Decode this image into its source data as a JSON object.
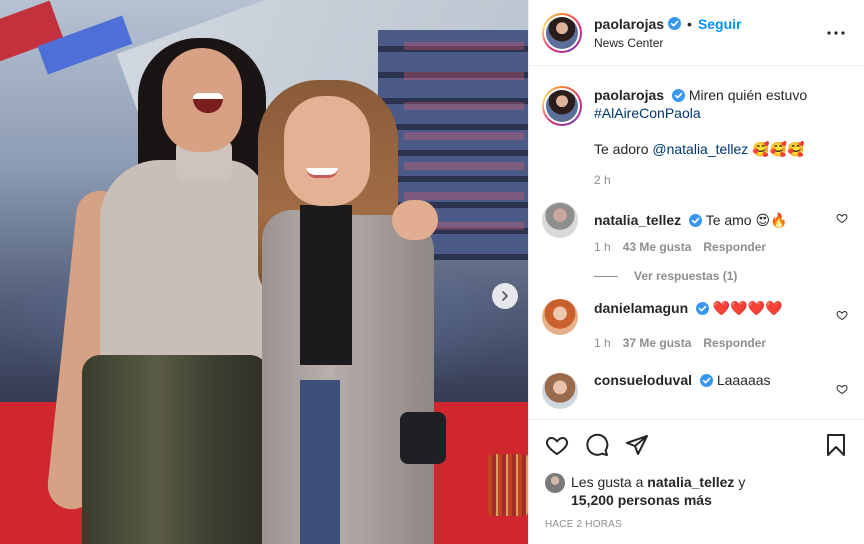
{
  "header": {
    "username": "paolarojas",
    "separator": "•",
    "follow_label": "Seguir",
    "location": "News Center"
  },
  "caption": {
    "username": "paolarojas",
    "text": "Miren quién estuvo",
    "hashtag": "#AlAireConPaola",
    "line2_prefix": "Te adoro ",
    "mention": "@natalia_tellez",
    "emoji": "🥰🥰🥰",
    "time": "2 h"
  },
  "comments": [
    {
      "username": "natalia_tellez",
      "verified": true,
      "text": "Te amo 😍🔥",
      "time": "1 h",
      "likes": "43 Me gusta",
      "reply_label": "Responder",
      "view_replies": "Ver respuestas (1)"
    },
    {
      "username": "danielamagun",
      "verified": true,
      "text": "❤️❤️❤️❤️",
      "time": "1 h",
      "likes": "37 Me gusta",
      "reply_label": "Responder"
    },
    {
      "username": "consueloduval",
      "verified": true,
      "text": "Laaaaas"
    }
  ],
  "likes_summary": {
    "prefix": "Les gusta a ",
    "user": "natalia_tellez",
    "connector": " y",
    "count_text": "15,200 personas más"
  },
  "timestamp": "Hace 2 horas",
  "colors": {
    "link_blue": "#0095f6",
    "verified_blue": "#3897f0",
    "text": "#262626",
    "muted": "#8e8e8e"
  },
  "icons": [
    "verified-badge-icon",
    "more-options-icon",
    "heart-icon",
    "comment-icon",
    "share-icon",
    "bookmark-icon",
    "chevron-right-icon"
  ]
}
